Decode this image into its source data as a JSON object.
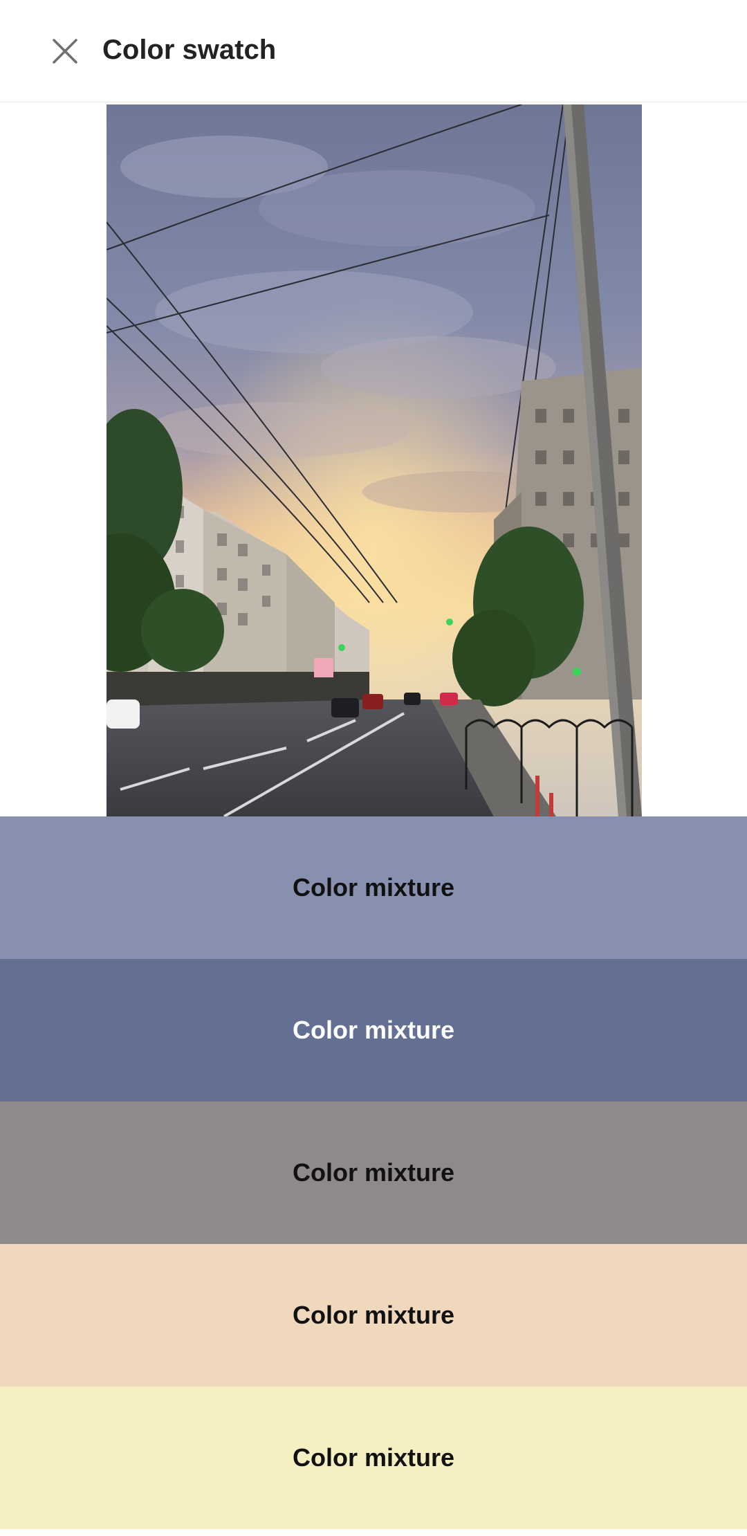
{
  "toolbar": {
    "title": "Color swatch",
    "close_icon": "close-icon"
  },
  "photo": {
    "subject": "city-street-sunset-photo"
  },
  "swatches": [
    {
      "label": "Color mixture",
      "color": "#8890AF",
      "text_color": "#111111"
    },
    {
      "label": "Color mixture",
      "color": "#647093",
      "text_color": "#FFFFFF"
    },
    {
      "label": "Color mixture",
      "color": "#8E8A89",
      "text_color": "#111111"
    },
    {
      "label": "Color mixture",
      "color": "#F0D8BD",
      "text_color": "#111111"
    },
    {
      "label": "Color mixture",
      "color": "#F6EFC1",
      "text_color": "#111111"
    }
  ]
}
